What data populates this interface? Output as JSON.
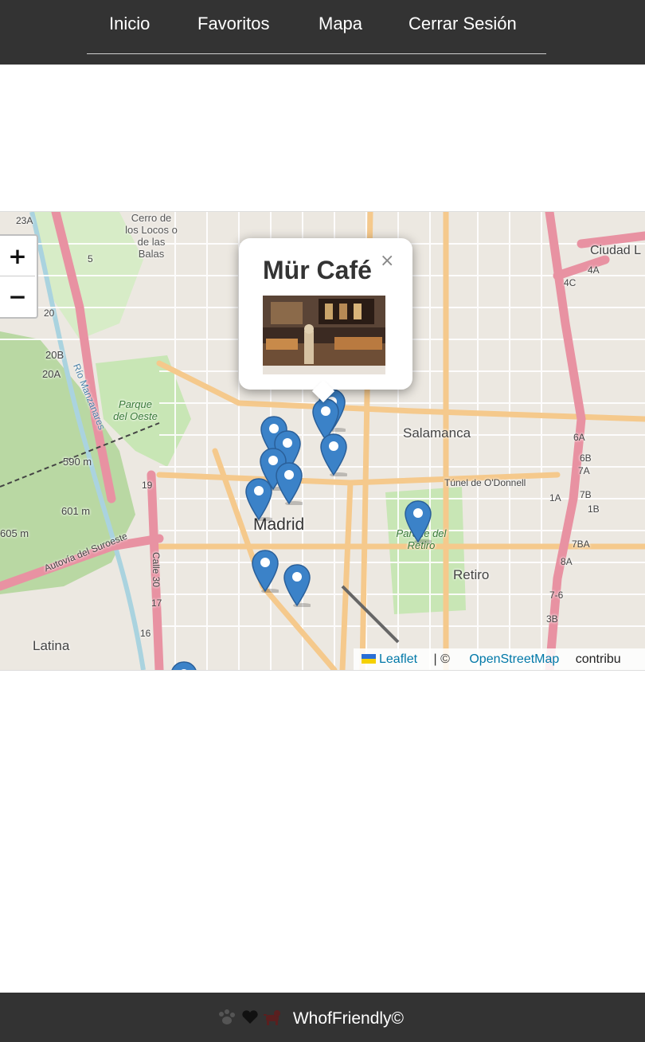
{
  "nav": {
    "links": [
      {
        "label": "Inicio"
      },
      {
        "label": "Favoritos"
      },
      {
        "label": "Mapa"
      },
      {
        "label": "Cerrar Sesión"
      }
    ]
  },
  "map": {
    "zoom_in": "+",
    "zoom_out": "−",
    "labels": {
      "madrid": "Madrid",
      "salamanca": "Salamanca",
      "retiro": "Retiro",
      "latina": "Latina",
      "ciudad": "Ciudad L",
      "parque_oeste": "Parque del Oeste",
      "parque_retiro": "Parque del Retiro",
      "cerro": "Cerro de los Locos o de las Balas",
      "tunel": "Túnel de O'Donnell",
      "autovia": "Autovía del Suroeste",
      "rio": "Río Manzanares",
      "alt_590": "590 m",
      "alt_601": "601 m",
      "alt_605": "605 m",
      "calle30": "Calle 30",
      "road_20b": "20B",
      "road_20a": "20A",
      "road_23a": "23A",
      "road_4c": "4C",
      "road_4a": "4A",
      "road_7b": "7B",
      "road_6a": "6A",
      "road_6b": "6B",
      "road_7a": "7A",
      "road_1a": "1A",
      "road_1b": "1B",
      "road_7ba": "7BA",
      "road_8a": "8A",
      "road_76": "7-6",
      "road_3b": "3B",
      "road_16": "16",
      "road_17": "17",
      "road_19": "19",
      "road_5": "5",
      "road_20": "20"
    },
    "popup": {
      "title": "Mür Café",
      "close": "×"
    },
    "attribution": {
      "leaflet": "Leaflet",
      "sep": "| ©",
      "osm": "OpenStreetMap",
      "contrib": "contribu"
    },
    "colors": {
      "marker": "#3b82c8",
      "land": "#f2efe9",
      "park": "#c8e6b5",
      "motorway": "#e892a2",
      "primary": "#fcd6a4",
      "water": "#aad3df"
    }
  },
  "footer": {
    "text": "WhofFriendly©",
    "icons": [
      "paw-icon",
      "heart-icon",
      "dog-icon"
    ]
  }
}
